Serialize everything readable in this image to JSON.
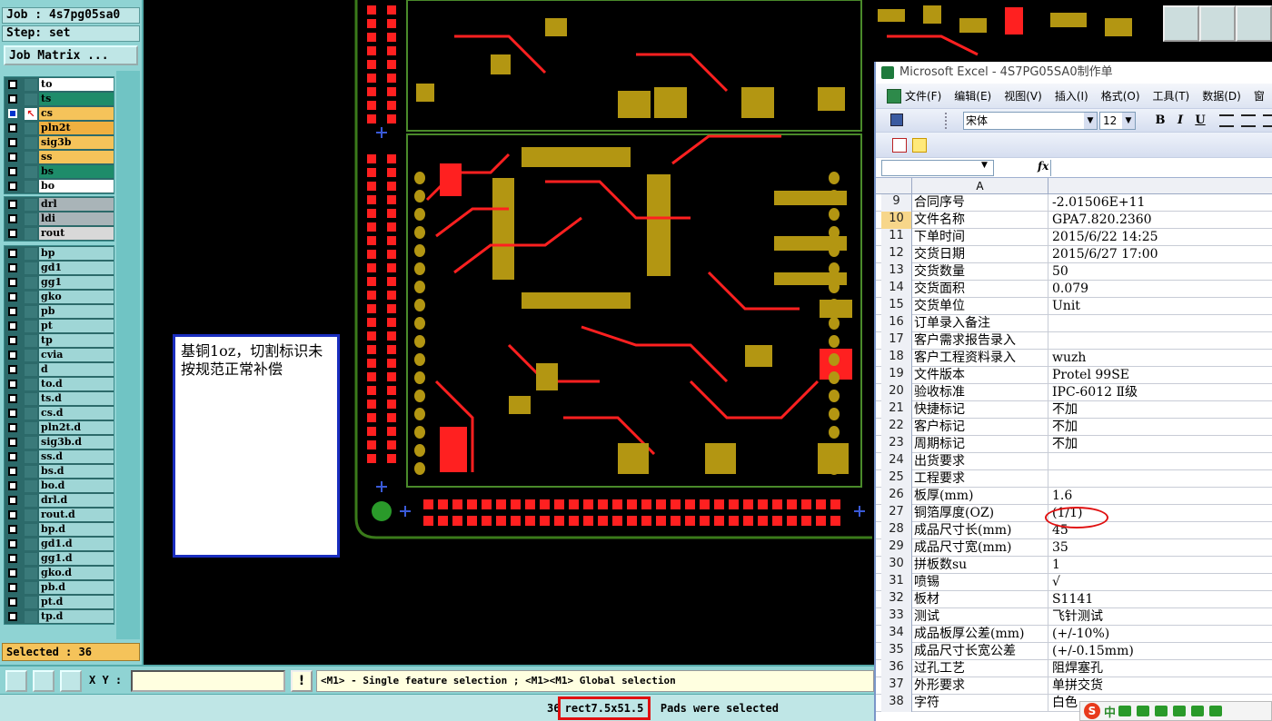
{
  "cam": {
    "job_label": "Job : 4s7pg05sa0",
    "step_label": "Step: set",
    "job_matrix_button": "Job Matrix ...",
    "selected_count": "Selected : 36",
    "layers_board": [
      {
        "name": "to",
        "color": "#ffffff"
      },
      {
        "name": "ts",
        "color": "#1e8c6a"
      },
      {
        "name": "cs",
        "color": "#f5c35a",
        "active": true
      },
      {
        "name": "pln2t",
        "color": "#f0b040"
      },
      {
        "name": "sig3b",
        "color": "#f5c35a"
      },
      {
        "name": "ss",
        "color": "#f5c35a"
      },
      {
        "name": "bs",
        "color": "#1e8c6a"
      },
      {
        "name": "bo",
        "color": "#ffffff"
      }
    ],
    "layers_drill": [
      {
        "name": "drl",
        "color": "#a9b4b8"
      },
      {
        "name": "ldi",
        "color": "#a9b4b8"
      },
      {
        "name": "rout",
        "color": "#d8d8d8"
      }
    ],
    "layers_misc": [
      {
        "name": "bp"
      },
      {
        "name": "gd1"
      },
      {
        "name": "gg1"
      },
      {
        "name": "gko"
      },
      {
        "name": "pb"
      },
      {
        "name": "pt"
      },
      {
        "name": "tp"
      },
      {
        "name": "cvia"
      },
      {
        "name": "d"
      },
      {
        "name": "to.d"
      },
      {
        "name": "ts.d"
      },
      {
        "name": "cs.d"
      },
      {
        "name": "pln2t.d"
      },
      {
        "name": "sig3b.d"
      },
      {
        "name": "ss.d"
      },
      {
        "name": "bs.d"
      },
      {
        "name": "bo.d"
      },
      {
        "name": "drl.d"
      },
      {
        "name": "rout.d"
      },
      {
        "name": "bp.d"
      },
      {
        "name": "gd1.d"
      },
      {
        "name": "gg1.d"
      },
      {
        "name": "gko.d"
      },
      {
        "name": "pb.d"
      },
      {
        "name": "pt.d"
      },
      {
        "name": "tp.d"
      }
    ],
    "xy_label": "X Y :",
    "xy_value": "",
    "alert_button": "!",
    "hint_text": "<M1> - Single feature selection ; <M1><M1> Global selection",
    "status_prefix": "36",
    "status_highlight": "rect7.5x51.5",
    "status_suffix": "Pads were selected"
  },
  "note": {
    "text": "基铜1oz，切割标识未按规范正常补偿"
  },
  "excel": {
    "title": "Microsoft Excel - 4S7PG05SA0制作单",
    "menu": [
      "文件(F)",
      "编辑(E)",
      "视图(V)",
      "插入(I)",
      "格式(O)",
      "工具(T)",
      "数据(D)",
      "窗"
    ],
    "font_name": "宋体",
    "font_size": "12",
    "bold_label": "B",
    "italic_label": "I",
    "underline_label": "U",
    "fx_label": "fx",
    "column_header": "A",
    "rows": [
      {
        "n": "9",
        "a": "合同序号",
        "b": "-2.01506E+11"
      },
      {
        "n": "10",
        "a": "文件名称",
        "b": "GPA7.820.2360",
        "active": true
      },
      {
        "n": "11",
        "a": "下单时间",
        "b": "2015/6/22 14:25"
      },
      {
        "n": "12",
        "a": "交货日期",
        "b": "2015/6/27 17:00"
      },
      {
        "n": "13",
        "a": "交货数量",
        "b": "50"
      },
      {
        "n": "14",
        "a": "交货面积",
        "b": "0.079"
      },
      {
        "n": "15",
        "a": "交货单位",
        "b": "Unit"
      },
      {
        "n": "16",
        "a": "订单录入备注",
        "b": ""
      },
      {
        "n": "17",
        "a": "客户需求报告录入",
        "b": ""
      },
      {
        "n": "18",
        "a": "客户工程资料录入",
        "b": "wuzh"
      },
      {
        "n": "19",
        "a": "文件版本",
        "b": "Protel 99SE"
      },
      {
        "n": "20",
        "a": "验收标准",
        "b": "IPC-6012 Ⅱ级"
      },
      {
        "n": "21",
        "a": "快捷标记",
        "b": "不加"
      },
      {
        "n": "22",
        "a": "客户标记",
        "b": "不加"
      },
      {
        "n": "23",
        "a": "周期标记",
        "b": "不加"
      },
      {
        "n": "24",
        "a": "出货要求",
        "b": ""
      },
      {
        "n": "25",
        "a": "工程要求",
        "b": ""
      },
      {
        "n": "26",
        "a": "板厚(mm)",
        "b": "1.6"
      },
      {
        "n": "27",
        "a": "铜箔厚度(OZ)",
        "b": "(1/1)"
      },
      {
        "n": "28",
        "a": "成品尺寸长(mm)",
        "b": "45"
      },
      {
        "n": "29",
        "a": "成品尺寸宽(mm)",
        "b": "35"
      },
      {
        "n": "30",
        "a": "拼板数su",
        "b": "1"
      },
      {
        "n": "31",
        "a": "喷锡",
        "b": "√"
      },
      {
        "n": "32",
        "a": "板材",
        "b": "S1141"
      },
      {
        "n": "33",
        "a": "测试",
        "b": "飞针测试"
      },
      {
        "n": "34",
        "a": "成品板厚公差(mm)",
        "b": "(+/-10%)"
      },
      {
        "n": "35",
        "a": "成品尺寸长宽公差",
        "b": "(+/-0.15mm)"
      },
      {
        "n": "36",
        "a": "过孔工艺",
        "b": "阻焊塞孔"
      },
      {
        "n": "37",
        "a": "外形要求",
        "b": "单拼交货"
      },
      {
        "n": "38",
        "a": "字符",
        "b": "白色"
      }
    ]
  },
  "ime": {
    "logo": "S",
    "mode": "中"
  }
}
